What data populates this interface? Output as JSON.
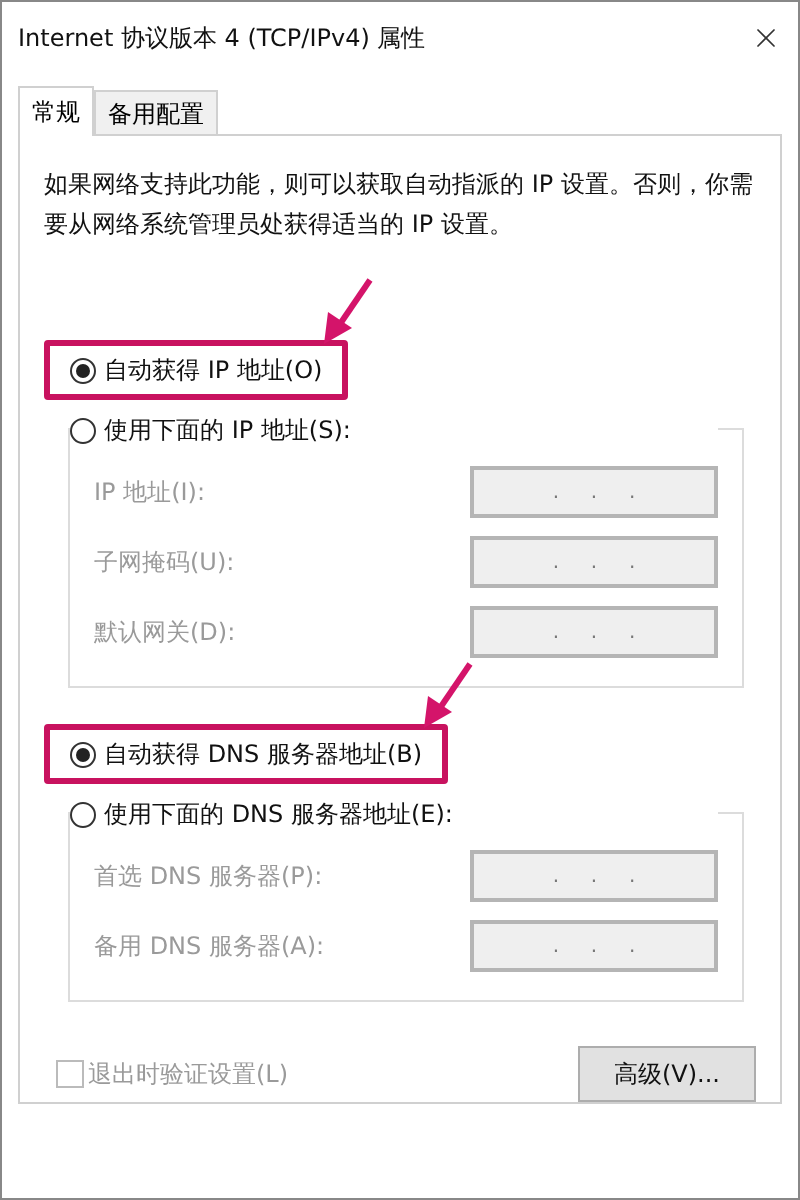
{
  "window": {
    "title": "Internet 协议版本 4 (TCP/IPv4) 属性"
  },
  "tabs": [
    {
      "label": "常规",
      "selected": true
    },
    {
      "label": "备用配置",
      "selected": false
    }
  ],
  "description": "如果网络支持此功能，则可以获取自动指派的 IP 设置。否则，你需要从网络系统管理员处获得适当的 IP 设置。",
  "ip_mode": [
    {
      "label": "自动获得 IP 地址(O)",
      "selected": true,
      "highlighted": true
    },
    {
      "label": "使用下面的 IP 地址(S):",
      "selected": false,
      "highlighted": false
    }
  ],
  "ip_fields": [
    {
      "label": "IP 地址(I):",
      "value": ".     .     .",
      "disabled": true
    },
    {
      "label": "子网掩码(U):",
      "value": ".     .     .",
      "disabled": true
    },
    {
      "label": "默认网关(D):",
      "value": ".     .     .",
      "disabled": true
    }
  ],
  "dns_mode": [
    {
      "label": "自动获得 DNS 服务器地址(B)",
      "selected": true,
      "highlighted": true
    },
    {
      "label": "使用下面的 DNS 服务器地址(E):",
      "selected": false,
      "highlighted": false
    }
  ],
  "dns_fields": [
    {
      "label": "首选 DNS 服务器(P):",
      "value": ".     .     .",
      "disabled": true
    },
    {
      "label": "备用 DNS 服务器(A):",
      "value": ".     .     .",
      "disabled": true
    }
  ],
  "validate_checkbox": {
    "label": "退出时验证设置(L)",
    "checked": false,
    "disabled": true
  },
  "advanced_button": {
    "label": "高级(V)..."
  }
}
